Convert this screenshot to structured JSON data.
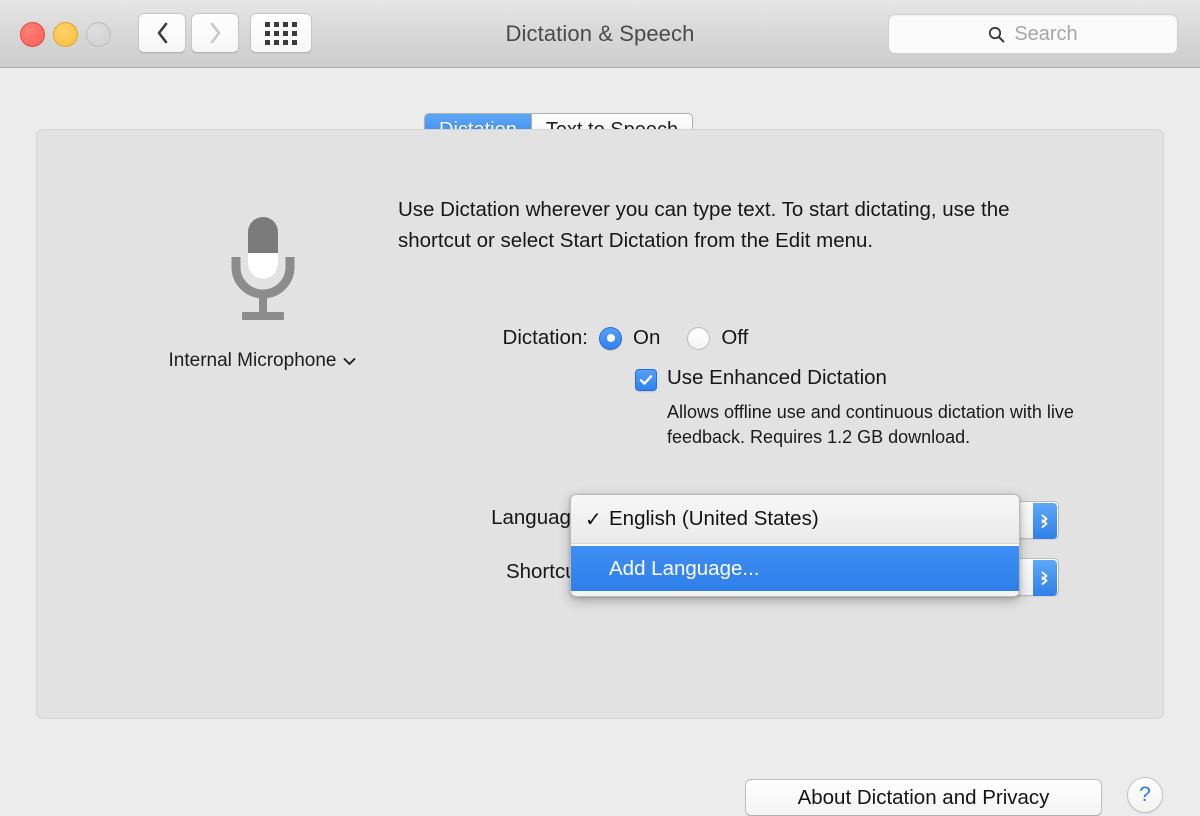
{
  "window": {
    "title": "Dictation & Speech",
    "traffic_lights": [
      "close",
      "minimize",
      "zoom"
    ],
    "nav": {
      "back": "back-icon",
      "forward": "forward-icon",
      "show_all": "grid-icon"
    },
    "search": {
      "placeholder": "Search",
      "icon": "search-icon",
      "value": ""
    }
  },
  "tabs": [
    {
      "label": "Dictation",
      "active": true
    },
    {
      "label": "Text to Speech",
      "active": false
    }
  ],
  "mic": {
    "icon": "microphone-icon",
    "label": "Internal Microphone",
    "chevron": "chevron-down-icon"
  },
  "main": {
    "description": "Use Dictation wherever you can type text. To start dictating, use the shortcut or select Start Dictation from the Edit menu.",
    "dictation": {
      "label": "Dictation:",
      "options": [
        {
          "label": "On",
          "selected": true
        },
        {
          "label": "Off",
          "selected": false
        }
      ]
    },
    "enhanced": {
      "label": "Use Enhanced Dictation",
      "checked": true,
      "help": "Allows offline use and continuous dictation with live feedback. Requires 1.2 GB download."
    },
    "language": {
      "label": "Language:",
      "value": "English (United States)"
    },
    "shortcut": {
      "label": "Shortcut:"
    }
  },
  "language_menu": {
    "open": true,
    "items": [
      {
        "label": "English (United States)",
        "checked": true,
        "check_glyph": "✓",
        "highlighted": false
      },
      {
        "label": "Add Language...",
        "checked": false,
        "check_glyph": "",
        "highlighted": true
      }
    ]
  },
  "footer": {
    "about_label": "About Dictation and Privacy",
    "help_label": "?"
  },
  "colors": {
    "accent_blue": "#2f7fe8",
    "highlight_blue": "#3e8ef5",
    "window_bg": "#ececec",
    "panel_bg": "#e2e2e2"
  }
}
